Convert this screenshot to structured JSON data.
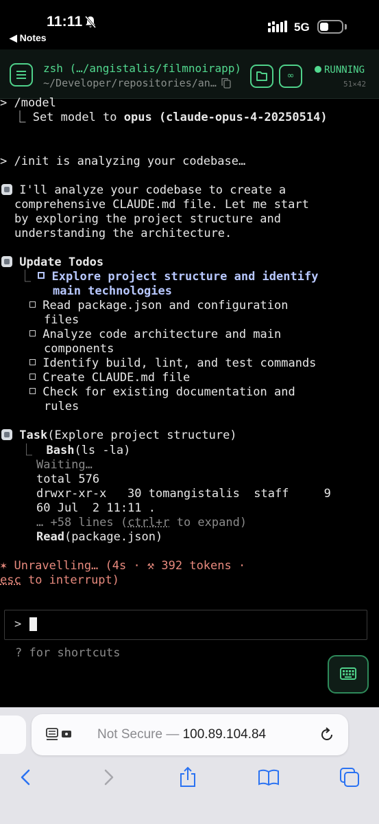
{
  "status_bar": {
    "time": "11:11",
    "back_app": "◀ Notes",
    "network": "5G"
  },
  "header": {
    "title": "zsh (…/angistalis/filmnoirapp)",
    "path": "~/Developer/repositories/an…",
    "status": "RUNNING",
    "dims": "51×42",
    "infinity_label": "∞"
  },
  "terminal": {
    "model_cmd": "> /model",
    "model_result_pre": "  ⎿ Set model to ",
    "model_result_bold": "opus (claude-opus-4-20250514)",
    "init_line": "> /init is analyzing your codebase…",
    "analyze_lines": [
      " I'll analyze your codebase to create a",
      "comprehensive CLAUDE.md file. Let me start",
      "by exploring the project structure and",
      "understanding the architecture."
    ],
    "update_todos": "Update Todos",
    "todos": [
      {
        "lines": [
          "Explore project structure and identify",
          "main technologies"
        ],
        "active": true
      },
      {
        "lines": [
          "Read package.json and configuration",
          "files"
        ],
        "active": false
      },
      {
        "lines": [
          "Analyze code architecture and main",
          "components"
        ],
        "active": false
      },
      {
        "lines": [
          "Identify build, lint, and test commands"
        ],
        "active": false
      },
      {
        "lines": [
          "Create CLAUDE.md file"
        ],
        "active": false
      },
      {
        "lines": [
          "Check for existing documentation and",
          "rules"
        ],
        "active": false
      }
    ],
    "task_name": "Task",
    "task_arg": "(Explore project structure)",
    "bash_name": "Bash",
    "bash_arg": "(ls -la)",
    "waiting": "Waiting…",
    "total": "total 576",
    "ls_line1": "drwxr-xr-x   30 tomangistalis  staff     9",
    "ls_line2": "60 Jul  2 11:11 .",
    "more_pre": "… +58 lines (",
    "more_key": "ctrl+r",
    "more_post": " to expand)",
    "read_name": "Read",
    "read_arg": "(package.json)",
    "spinner_line1": "✶ Unravelling… (4s · ⚒ 392 tokens ·",
    "spinner_esc": "esc",
    "spinner_line2_rest": " to interrupt)",
    "prompt_char": ">",
    "shortcuts": "? for shortcuts"
  },
  "safari": {
    "not_secure": "Not Secure —",
    "host": "100.89.104.84"
  },
  "colors": {
    "accent": "#52d98f",
    "todo_active": "#b8c8ff",
    "spinner": "#e88a7e"
  }
}
